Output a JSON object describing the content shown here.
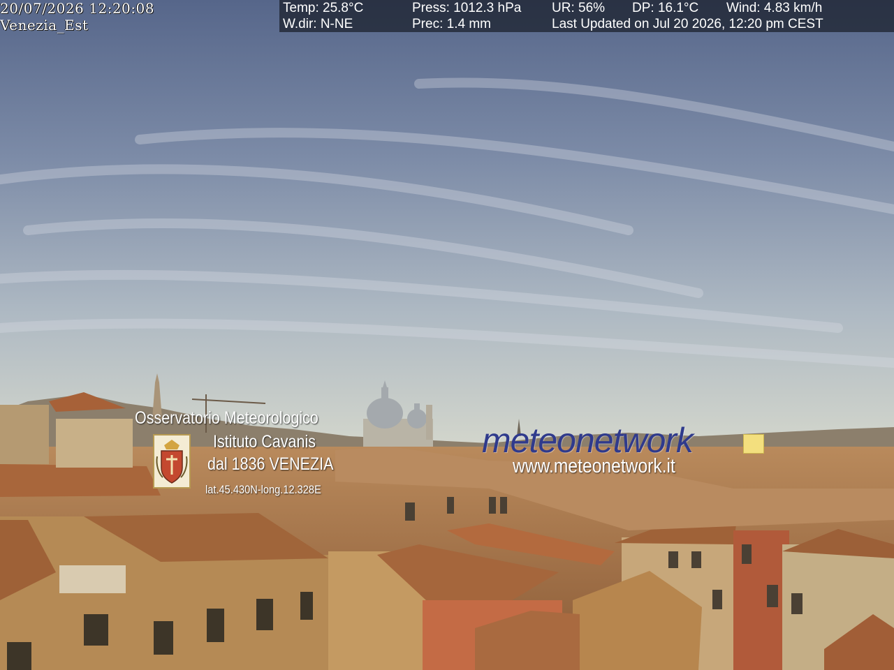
{
  "camera": {
    "timestamp": "20/07/2026 12:20:08",
    "name": "Venezia_Est"
  },
  "weather": {
    "temp": "Temp: 25.8°C",
    "press": "Press: 1012.3 hPa",
    "ur": "UR: 56%",
    "dp": "DP: 16.1°C",
    "wind": "Wind: 4.83 km/h",
    "wdir": "W.dir: N-NE",
    "prec": "Prec: 1.4 mm",
    "updated": "Last Updated on Jul 20 2026, 12:20 pm CEST"
  },
  "observatory": {
    "line1": "Osservatorio  Meteorologico",
    "line2": "Istituto  Cavanis",
    "line3": "dal 1836 VENEZIA",
    "coords": "lat.45.430N-long.12.328E"
  },
  "network": {
    "logo": "meteonetwork",
    "url": "www.meteonetwork.it",
    "logo_color": "#2f3a8c",
    "square_color": "#f3df7e"
  },
  "scene": {
    "sky_top": "#5f6e8e",
    "sky_horizon": "#c9cfc8",
    "roof_color": "#b5683a",
    "wall_color": "#c8a56d"
  }
}
